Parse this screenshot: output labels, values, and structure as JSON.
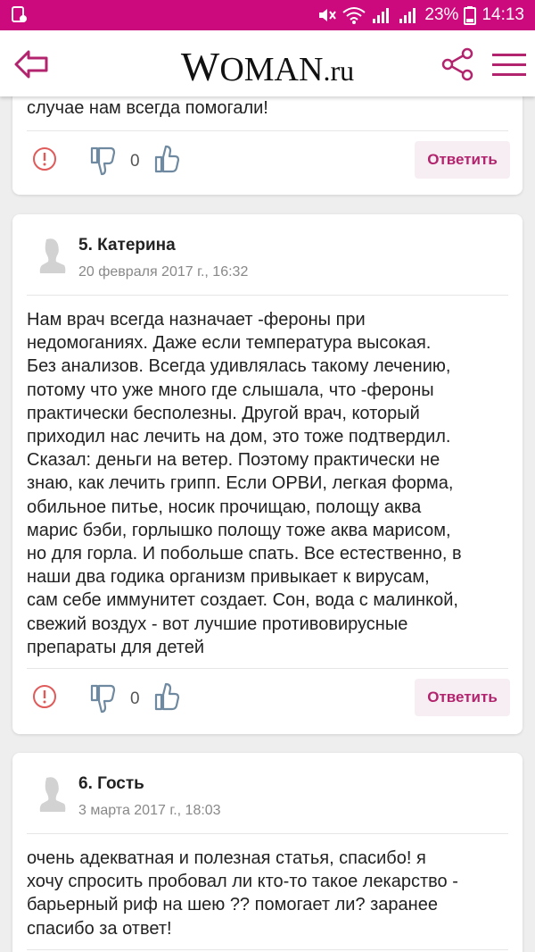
{
  "status_bar": {
    "battery": "23%",
    "time": "14:13",
    "bg_color": "#cc0a7d"
  },
  "app_bar": {
    "logo_w": "W",
    "logo_oman": "OMAN",
    "logo_ru": ".ru",
    "icons": [
      "back-arrow-icon",
      "share-icon",
      "menu-icon"
    ],
    "accent_color": "#cc0a7d"
  },
  "comments": [
    {
      "text": "случае нам всегда помогали!",
      "votes": "0",
      "reply_label": "Ответить"
    },
    {
      "author": "5. Катерина",
      "date": "20 февраля 2017 г., 16:32",
      "lines": [
        "Нам врач всегда назначает -фероны при",
        "недомоганиях. Даже если температура высокая.",
        "Без анализов. Всегда удивлялась такому лечению,",
        "потому что уже много где слышала, что -фероны",
        "практически бесполезны. Другой врач, который",
        "приходил нас лечить на дом, это тоже подтвердил.",
        "Сказал: деньги на ветер. Поэтому практически не",
        "знаю, как лечить грипп. Если ОРВИ, легкая форма,",
        "обильное питье, носик прочищаю, полощу аква",
        "марис бэби, горлышко полощу тоже аква марисом,",
        "но для горла. И побольше спать. Все естественно, в",
        "наши два годика организм привыкает к вирусам,",
        "сам себе иммунитет создает. Сон, вода с малинкой,",
        "свежий воздух - вот лучшие противовирусные",
        "препараты для детей"
      ],
      "votes": "0",
      "reply_label": "Ответить"
    },
    {
      "author": "6. Гость",
      "date": "3 марта 2017 г., 18:03",
      "lines": [
        "очень адекватная и полезная статья, спасибо! я",
        "хочу спросить пробовал ли кто-то такое лекарство -",
        "барьерный риф на шею ?? помогает ли? заранее",
        "спасибо за ответ!"
      ]
    }
  ]
}
